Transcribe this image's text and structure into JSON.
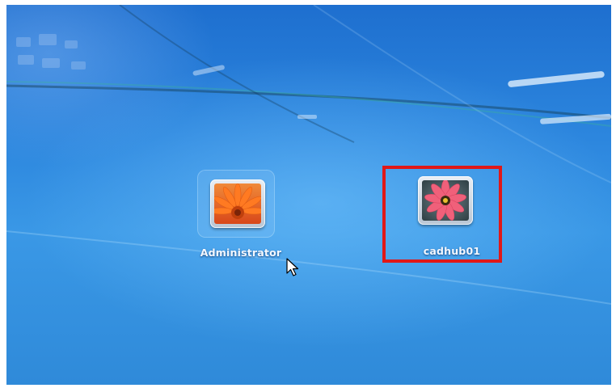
{
  "users": [
    {
      "name": "Administrator",
      "picture": "orange-gerbera-flower-icon"
    },
    {
      "name": "cadhub01",
      "picture": "pink-flower-icon"
    }
  ],
  "highlight": {
    "target": "cadhub01",
    "color": "#e01818"
  },
  "colors": {
    "background": "#2c86de",
    "label_text": "#f4f8ff"
  },
  "cursor": "arrow-cursor-icon"
}
